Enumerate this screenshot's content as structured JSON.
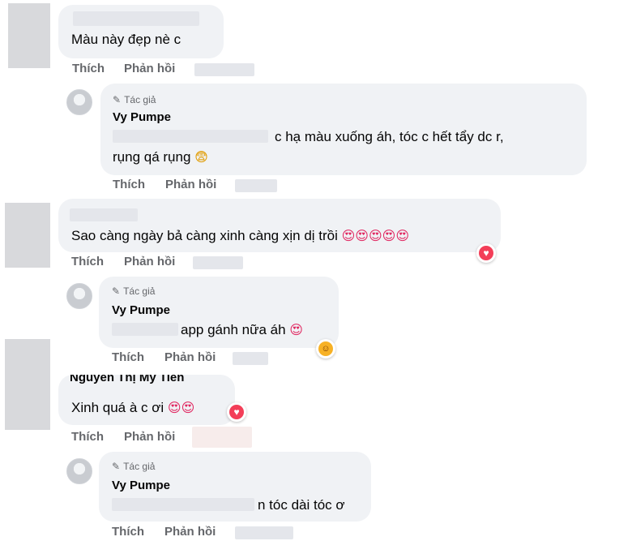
{
  "colors": {
    "bubble": "#f0f2f5",
    "secondary_text": "#65676b",
    "heart_reaction": "#f33e58",
    "care_reaction": "#f7b125"
  },
  "actions": {
    "like": "Thích",
    "reply": "Phản hồi"
  },
  "author_badge": "Tác giả",
  "comments": [
    {
      "text": "Màu này đẹp nè c",
      "replies": [
        {
          "name": "Vy Pumpe",
          "line1": "c hạ màu xuống áh, tóc c hết tẩy dc r,",
          "line2": "rụng qá rụng",
          "line2_emoji": "😨"
        }
      ]
    },
    {
      "text": "Sao càng ngày bả càng xinh càng xịn dị trồi",
      "emojis": "😍😍😍😍😍",
      "reaction_icon": "heart-reaction-icon",
      "replies": [
        {
          "name": "Vy Pumpe",
          "line1": "app gánh nữa áh",
          "line1_emoji": "😍",
          "reaction_icon": "care-reaction-icon"
        }
      ]
    },
    {
      "author_partial": "Nguyễn Thị Mỹ Tiên",
      "text": "Xinh quá à c ơi",
      "emojis": "😍😍",
      "reaction_icon": "heart-reaction-icon",
      "replies": [
        {
          "name": "Vy Pumpe",
          "line1": "n tóc dài tóc ơ"
        }
      ]
    }
  ]
}
